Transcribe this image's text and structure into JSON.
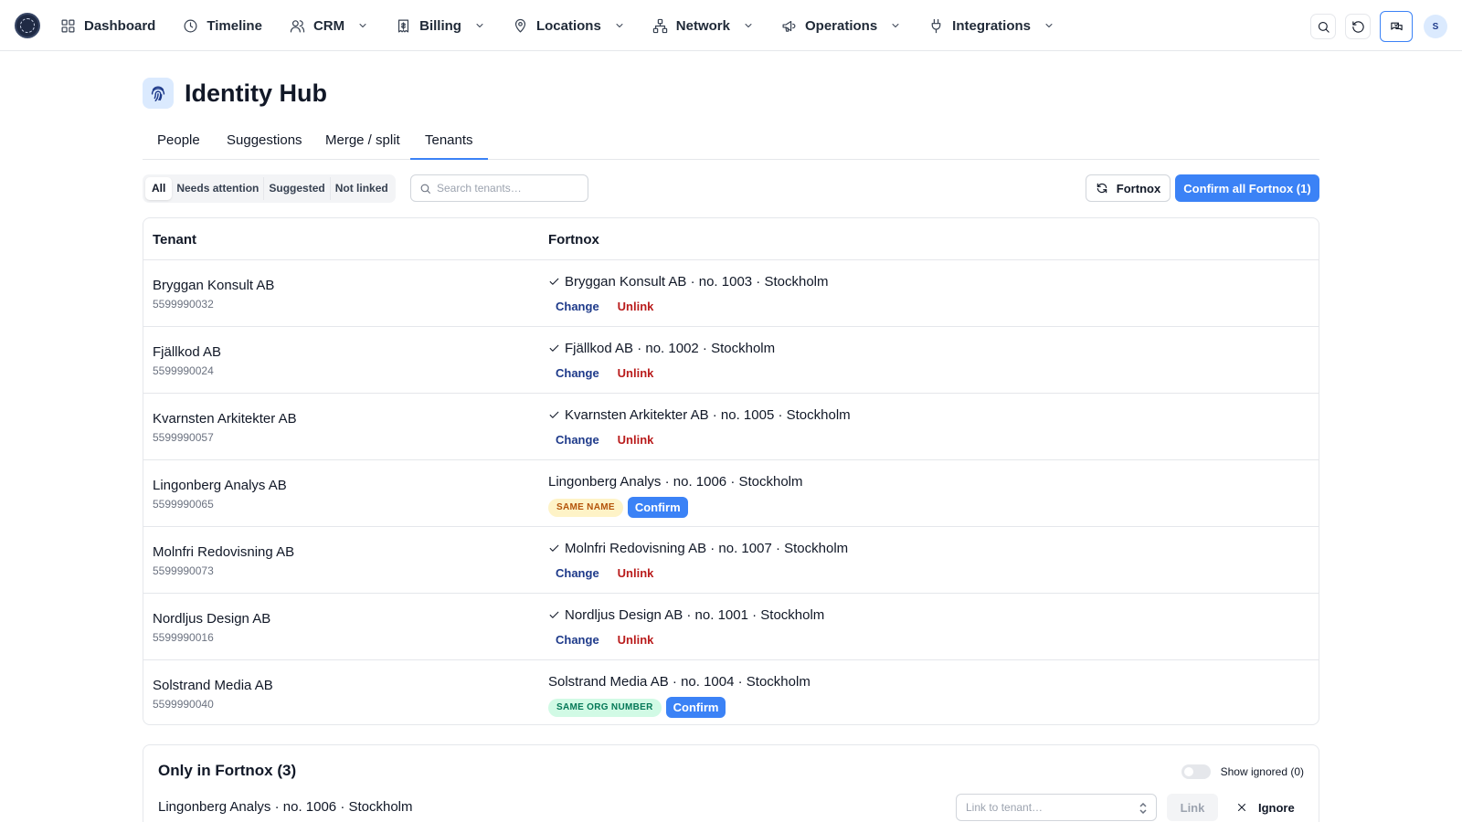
{
  "nav": {
    "items": [
      {
        "label": "Dashboard",
        "icon": "grid-icon",
        "dropdown": false
      },
      {
        "label": "Timeline",
        "icon": "clock-icon",
        "dropdown": false
      },
      {
        "label": "CRM",
        "icon": "users-icon",
        "dropdown": true
      },
      {
        "label": "Billing",
        "icon": "receipt-icon",
        "dropdown": true
      },
      {
        "label": "Locations",
        "icon": "map-pin-icon",
        "dropdown": true
      },
      {
        "label": "Network",
        "icon": "network-icon",
        "dropdown": true
      },
      {
        "label": "Operations",
        "icon": "megaphone-icon",
        "dropdown": true
      },
      {
        "label": "Integrations",
        "icon": "plug-icon",
        "dropdown": true
      }
    ],
    "avatar_initial": "S"
  },
  "page": {
    "title": "Identity Hub",
    "icon": "fingerprint-icon"
  },
  "tabs": [
    {
      "label": "People",
      "active": false
    },
    {
      "label": "Suggestions",
      "active": false
    },
    {
      "label": "Merge / split",
      "active": false
    },
    {
      "label": "Tenants",
      "active": true
    }
  ],
  "filters": {
    "segments": [
      {
        "label": "All",
        "active": true
      },
      {
        "label": "Needs attention",
        "active": false
      },
      {
        "label": "Suggested",
        "active": false
      },
      {
        "label": "Not linked",
        "active": false
      }
    ],
    "search_placeholder": "Search tenants…",
    "sync_label": "Fortnox",
    "confirm_all_label": "Confirm all Fortnox (1)"
  },
  "table": {
    "headers": {
      "tenant": "Tenant",
      "fortnox": "Fortnox"
    },
    "rows": [
      {
        "name": "Bryggan Konsult AB",
        "org": "5599990032",
        "fortnox": "Bryggan Konsult AB · no. 1003 · Stockholm",
        "status": "linked"
      },
      {
        "name": "Fjällkod AB",
        "org": "5599990024",
        "fortnox": "Fjällkod AB · no. 1002 · Stockholm",
        "status": "linked"
      },
      {
        "name": "Kvarnsten Arkitekter AB",
        "org": "5599990057",
        "fortnox": "Kvarnsten Arkitekter AB · no. 1005 · Stockholm",
        "status": "linked"
      },
      {
        "name": "Lingonberg Analys AB",
        "org": "5599990065",
        "fortnox": "Lingonberg Analys · no. 1006 · Stockholm",
        "status": "suggested",
        "badge": "SAME NAME",
        "badge_color": "#fef3c7"
      },
      {
        "name": "Molnfri Redovisning AB",
        "org": "5599990073",
        "fortnox": "Molnfri Redovisning AB · no. 1007 · Stockholm",
        "status": "linked"
      },
      {
        "name": "Nordljus Design AB",
        "org": "5599990016",
        "fortnox": "Nordljus Design AB · no. 1001 · Stockholm",
        "status": "linked"
      },
      {
        "name": "Solstrand Media AB",
        "org": "5599990040",
        "fortnox": "Solstrand Media AB · no. 1004 · Stockholm",
        "status": "suggested",
        "badge": "SAME ORG NUMBER",
        "badge_color": "#d1fae5"
      }
    ],
    "change_label": "Change",
    "unlink_label": "Unlink",
    "confirm_label": "Confirm"
  },
  "only_in_fortnox": {
    "title": "Only in Fortnox (3)",
    "show_ignored_label": "Show ignored (0)",
    "show_ignored": false,
    "items": [
      {
        "label": "Lingonberg Analys · no. 1006 · Stockholm"
      }
    ],
    "link_placeholder": "Link to tenant…",
    "link_label": "Link",
    "ignore_label": "Ignore"
  },
  "colors": {
    "accent": "#3b82f6",
    "change_link": "#1e3a8a",
    "unlink_link": "#b91c1c"
  }
}
